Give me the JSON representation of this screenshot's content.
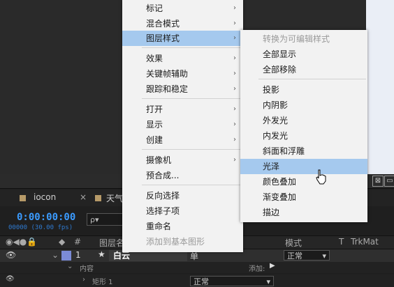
{
  "main_menu": {
    "items": [
      {
        "label": "标记",
        "submenu": true
      },
      {
        "label": "混合模式",
        "submenu": true
      },
      {
        "label": "图层样式",
        "submenu": true,
        "highlighted": true
      },
      {
        "label": "效果",
        "submenu": true
      },
      {
        "label": "关键帧辅助",
        "submenu": true
      },
      {
        "label": "跟踪和稳定",
        "submenu": true
      },
      {
        "label": "打开",
        "submenu": true
      },
      {
        "label": "显示",
        "submenu": true
      },
      {
        "label": "创建",
        "submenu": true
      },
      {
        "label": "摄像机",
        "submenu": true
      },
      {
        "label": "预合成..."
      },
      {
        "label": "反向选择"
      },
      {
        "label": "选择子项"
      },
      {
        "label": "重命名"
      },
      {
        "label": "添加到基本图形",
        "disabled": true
      }
    ]
  },
  "sub_menu": {
    "items": [
      {
        "label": "转换为可编辑样式",
        "disabled": true
      },
      {
        "label": "全部显示"
      },
      {
        "label": "全部移除"
      },
      {
        "label": "投影"
      },
      {
        "label": "内阴影"
      },
      {
        "label": "外发光"
      },
      {
        "label": "内发光"
      },
      {
        "label": "斜面和浮雕"
      },
      {
        "label": "光泽",
        "highlighted": true
      },
      {
        "label": "颜色叠加"
      },
      {
        "label": "渐变叠加"
      },
      {
        "label": "描边"
      }
    ]
  },
  "timeline": {
    "tabs": [
      "iocon",
      "天气"
    ],
    "tab_close": "×",
    "timecode": "0:00:00:00",
    "fps": "00000 (30.00 fps)",
    "search_icon": "ρ▾",
    "headers": {
      "layer_name": "图层名",
      "mode": "模式",
      "t": "T",
      "trkmat": "TrkMat"
    },
    "layer": {
      "index": "1",
      "star": "★",
      "name": "白云",
      "single": "单",
      "mode": "正常",
      "color": "#7b8bd6"
    },
    "content_row": {
      "label": "内容",
      "add": "添加:"
    },
    "rect_row": {
      "label": "矩形 1",
      "mode": "正常"
    }
  },
  "colors": {
    "menu_bg": "#f2f2f2",
    "highlight": "#a5c9ee",
    "timecode": "#3b9bff"
  }
}
